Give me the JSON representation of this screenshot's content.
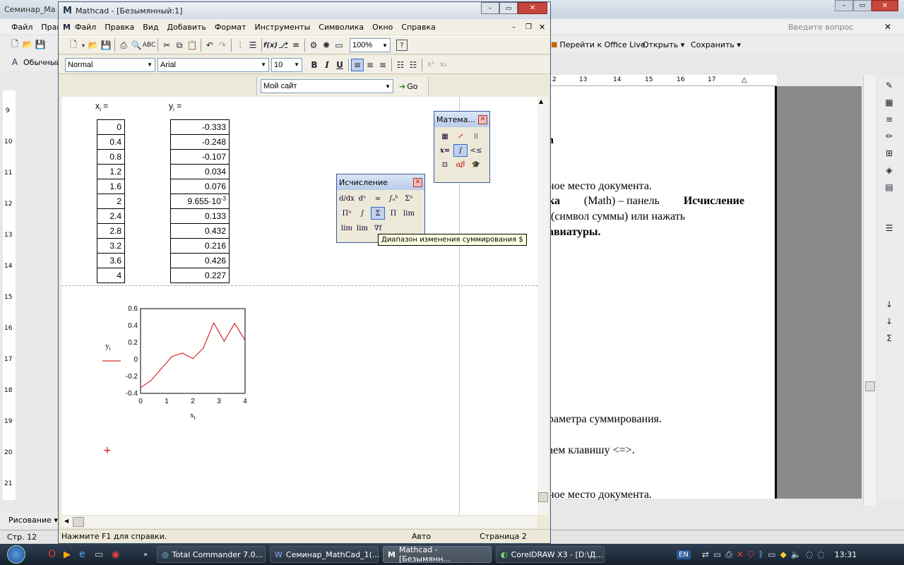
{
  "word": {
    "title": "Семинар_Ма",
    "menu": [
      "Файл",
      "Прав"
    ],
    "style_label": "Обычный",
    "help_placeholder": "Введите вопрос",
    "office_live": "Перейти к Office Live",
    "open": "Открыть",
    "save": "Сохранить",
    "ruler": [
      "2",
      "13",
      "14",
      "15",
      "16",
      "17"
    ],
    "vruler": [
      "9",
      "10",
      "11",
      "12",
      "13",
      "14",
      "15",
      "16",
      "17",
      "18",
      "19",
      "20",
      "21"
    ],
    "lines": [
      {
        "text": "а",
        "bold": true
      },
      {
        "text": "ное место документа.",
        "bold": false
      },
      {
        "text_b1": "ка",
        "text_n": " (Math) – панель ",
        "text_b2": "Исчисление"
      },
      {
        "text": " (символ суммы) или нажать",
        "bold": false
      },
      {
        "text": "авиатуры.",
        "bold": true
      },
      {
        "text": "раметра суммирования.",
        "bold": false
      },
      {
        "text": "аем клавишу <=>.",
        "bold": false
      },
      {
        "text": "ное место документа.",
        "bold": false
      }
    ],
    "drawing": "Рисование",
    "status_page": "Стр. 12"
  },
  "mathcad": {
    "title": "Mathcad - [Безымянный:1]",
    "menu": [
      "Файл",
      "Правка",
      "Вид",
      "Добавить",
      "Формат",
      "Инструменты",
      "Символика",
      "Окно",
      "Справка"
    ],
    "zoom": "100%",
    "style": "Normal",
    "font": "Arial",
    "size": "10",
    "site": "Мой сайт",
    "go": "Go",
    "x_label": "x",
    "y_label": "y",
    "sub": "i",
    "eq": "=",
    "x_values": [
      "0",
      "0.4",
      "0.8",
      "1.2",
      "1.6",
      "2",
      "2.4",
      "2.8",
      "3.2",
      "3.6",
      "4"
    ],
    "y_values": [
      "-0.333",
      "-0.248",
      "-0.107",
      "0.034",
      "0.076",
      "9.655·10",
      "0.133",
      "0.432",
      "0.216",
      "0.426",
      "0.227"
    ],
    "y_exp": "-3",
    "status_help": "Нажмите F1 для справки.",
    "status_mode": "Авто",
    "status_page": "Страница 2"
  },
  "palette_calc": {
    "title": "Исчисление",
    "tooltip": "Диапазон изменения суммирования $"
  },
  "palette_math": {
    "title": "Матема..."
  },
  "chart_data": {
    "type": "line",
    "x": [
      0,
      0.4,
      0.8,
      1.2,
      1.6,
      2,
      2.4,
      2.8,
      3.2,
      3.6,
      4
    ],
    "series": [
      {
        "values": [
          -0.333,
          -0.248,
          -0.107,
          0.034,
          0.076,
          0.009655,
          0.133,
          0.432,
          0.216,
          0.426,
          0.227
        ],
        "color": "#cc0000"
      }
    ],
    "xlim": [
      0,
      4
    ],
    "ylim": [
      -0.4,
      0.6
    ],
    "xticks": [
      "0",
      "1",
      "2",
      "3",
      "4"
    ],
    "yticks": [
      "0.6",
      "0.4",
      "0.2",
      "0",
      "-0.2",
      "-0.4"
    ],
    "xlabel": "x",
    "ylabel": "y",
    "label_sub": "i"
  },
  "taskbar": {
    "items": [
      "Total Commander 7.0...",
      "Семинар_MathCad_1(...",
      "Mathcad - [Безымянн...",
      "CorelDRAW X3 - [D:\\Д..."
    ],
    "lang": "EN",
    "clock": "13:31"
  },
  "colors": {
    "accent": "#245edb",
    "plot": "#cc0000",
    "taskbar": "#1b2a3a"
  }
}
